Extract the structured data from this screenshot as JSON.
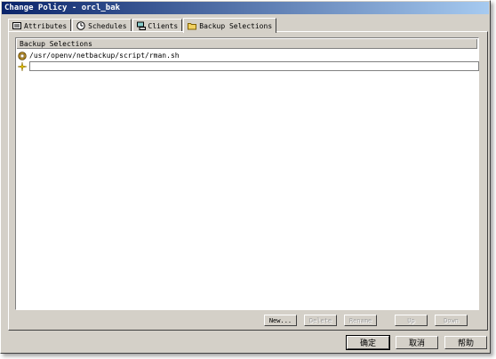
{
  "window": {
    "title": "Change Policy - orcl_bak"
  },
  "tabs": [
    {
      "label": "Attributes",
      "icon": "attributes-icon",
      "active": false
    },
    {
      "label": "Schedules",
      "icon": "schedules-icon",
      "active": false
    },
    {
      "label": "Clients",
      "icon": "clients-icon",
      "active": false
    },
    {
      "label": "Backup Selections",
      "icon": "folder-icon",
      "active": true
    }
  ],
  "selections": {
    "header": "Backup Selections",
    "items": [
      {
        "path": "/usr/openv/netbackup/script/rman.sh",
        "icon": "script-icon"
      }
    ],
    "new_entry_value": ""
  },
  "list_buttons": {
    "new": "New...",
    "delete": "Delete",
    "rename": "Rename",
    "up": "Up",
    "down": "Down"
  },
  "dialog_buttons": {
    "ok": "确定",
    "cancel": "取消",
    "help": "帮助"
  },
  "colors": {
    "title_start": "#0a246a",
    "title_end": "#a6caf0",
    "face": "#d4d0c8"
  }
}
